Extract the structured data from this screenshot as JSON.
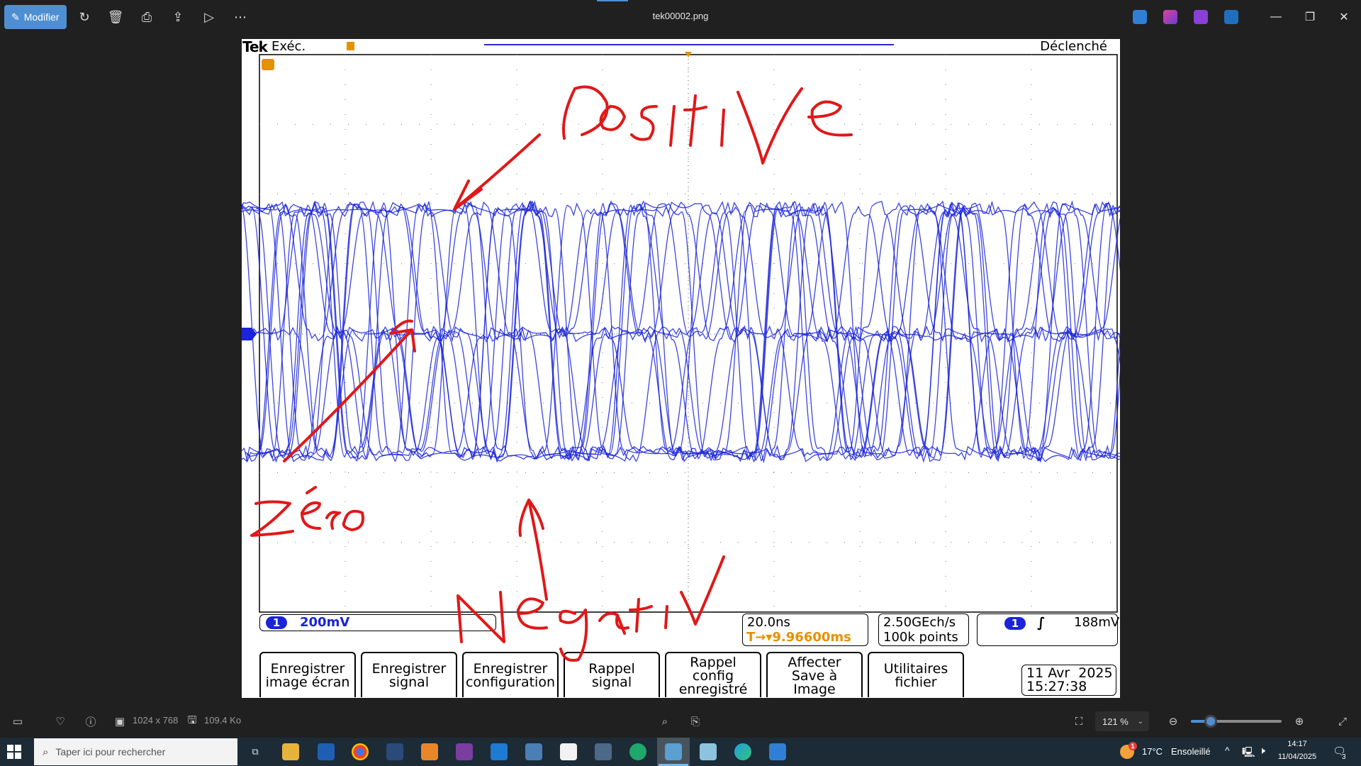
{
  "app": {
    "title": "tek00002.png",
    "edit_label": "Modifier",
    "toolbar_icons": [
      "rotate-icon",
      "delete-icon",
      "print-icon",
      "share-icon",
      "slideshow-icon",
      "more-icon"
    ],
    "window_controls": [
      "minimize-icon",
      "maximize-icon",
      "close-icon"
    ]
  },
  "scope": {
    "brand": "Tek",
    "run_state": "Exéc.",
    "trigger_state": "Déclenché",
    "ch1_marker": "1",
    "trigger_marker": "T",
    "ch1_scale": "200mV",
    "timebase": "20.0ns",
    "trigger_position": "9.96600ms",
    "sample_rate": "2.50GEch/s",
    "record_length": "100k points",
    "trigger_level": "188mV",
    "softkeys": [
      {
        "line1": "Enregistrer",
        "line2": "image écran",
        "line3": ""
      },
      {
        "line1": "Enregistrer",
        "line2": "signal",
        "line3": ""
      },
      {
        "line1": "Enregistrer",
        "line2": "configuration",
        "line3": ""
      },
      {
        "line1": "Rappel",
        "line2": "signal",
        "line3": ""
      },
      {
        "line1": "Rappel",
        "line2": "config",
        "line3": "enregistré"
      },
      {
        "line1": "Affecter",
        "line2": "Save à",
        "line3": "Image"
      },
      {
        "line1": "Utilitaires",
        "line2": "fichier",
        "line3": ""
      }
    ],
    "date": "11 Avr  2025",
    "time": "15:27:38",
    "colors": {
      "trace": "#1b24d8",
      "annotation": "#e01818",
      "trigger": "#e69100"
    }
  },
  "annotations": {
    "top": "Positive",
    "left": "zéro",
    "bottom": "Negativ"
  },
  "bottombar": {
    "dimensions": "1024 x 768",
    "file_size": "109.4 Ko",
    "zoom": "121 %",
    "zoom_level": 0.22
  },
  "taskbar": {
    "search_placeholder": "Taper ici pour rechercher",
    "weather_temp": "17°C",
    "weather_text": "Ensoleillé",
    "weather_badge": "1",
    "clock_time": "14:17",
    "clock_date": "11/04/2025",
    "notification_count": "3"
  }
}
